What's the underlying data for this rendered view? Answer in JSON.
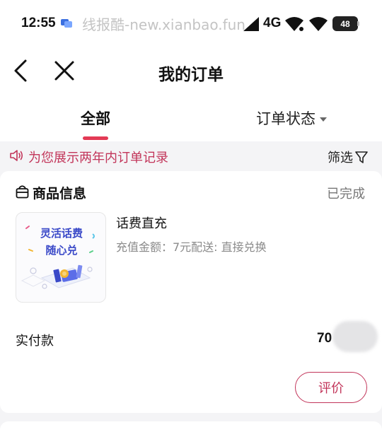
{
  "status_bar": {
    "time": "12:55",
    "watermark": "线报酷-new.xianbao.fun",
    "network": "4G",
    "battery": "48"
  },
  "nav": {
    "title": "我的订单"
  },
  "tabs": {
    "all_label": "全部",
    "status_label": "订单状态"
  },
  "notice": {
    "text": "为您展示两年内订单记录",
    "filter_label": "筛选"
  },
  "order": {
    "section_title": "商品信息",
    "status": "已完成",
    "thumbnail": {
      "line1": "灵活话费",
      "line2": "随心兑"
    },
    "product_name": "话费直充",
    "product_detail": "充值金额：7元配送: 直接兑换",
    "paid_label": "实付款",
    "paid_amount": "70",
    "review_label": "评价"
  },
  "colors": {
    "accent": "#c2355a",
    "tab_indicator": "#e33a55",
    "thumb_text": "#3a49c8"
  }
}
